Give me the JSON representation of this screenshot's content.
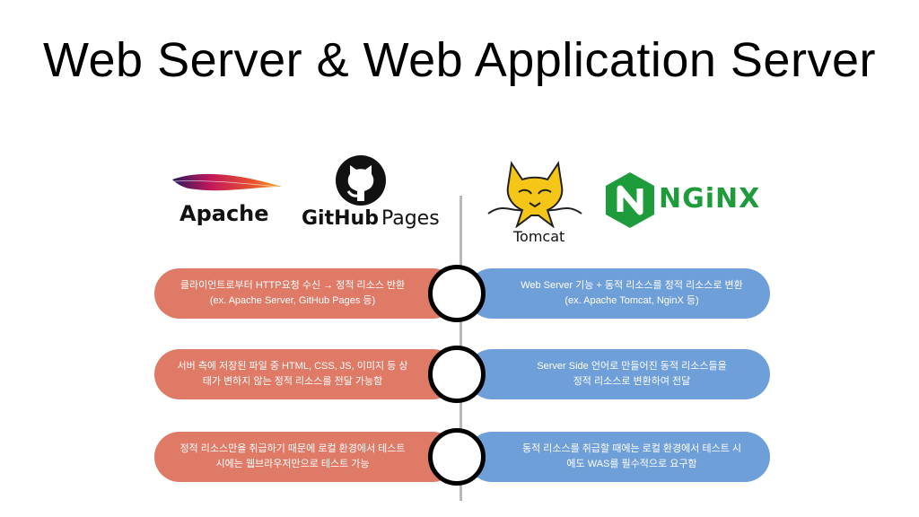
{
  "title": "Web Server & Web Application Server",
  "logos": {
    "apache": "Apache",
    "github_word": "GitHub",
    "github_pages": "Pages",
    "tomcat": "Tomcat",
    "nginx": "NGiNX"
  },
  "colors": {
    "left_pill": "#de7a66",
    "right_pill": "#6f9fd8",
    "nginx_green": "#1e9b3a"
  },
  "rows": [
    {
      "left": [
        "클라이언트로부터 HTTP요청 수신 → 정적 리소스 반환",
        "(ex. Apache Server, GitHub Pages 등)"
      ],
      "right": [
        "Web Server 기능 + 동적 리소스를 정적 리소스로 변환",
        "(ex. Apache Tomcat, NginX 등)"
      ]
    },
    {
      "left": [
        "서버 측에 저장된 파일 중 HTML, CSS, JS, 이미지 등 상",
        "태가 변하지 않는 정적 리소스를 전달 가능함"
      ],
      "right": [
        "Server Side 언어로 만들어진 동적 리소스들을",
        "정적 리소스로 변환하여 전달"
      ]
    },
    {
      "left": [
        "정적 리소스만을 취급하기 때문에 로컬 환경에서 테스트",
        "시에는 웹브라우저만으로 테스트 가능"
      ],
      "right": [
        "동적 리소스를 취급할 때에는 로컬 환경에서 테스트 시",
        "에도 WAS를 필수적으로 요구함"
      ]
    }
  ]
}
